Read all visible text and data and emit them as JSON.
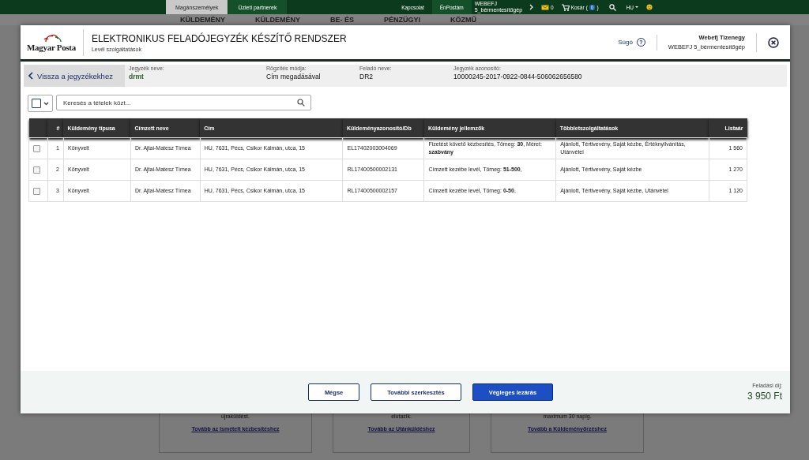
{
  "top_bar": {
    "tabs": [
      {
        "label": "Magánszemélyek",
        "selected": true
      },
      {
        "label": "Üzleti partnerek",
        "selected": false
      }
    ],
    "links": [
      "Kapcsolat",
      "ÉnPostám"
    ],
    "account": [
      "WEBEFJ",
      "5_bérmentesítőgép"
    ],
    "messages_count": "0",
    "cart": {
      "label": "Kosár",
      "open": "(",
      "count": "0",
      "close": ")"
    },
    "language": "HU"
  },
  "nav": [
    "KÜLDEMÉNY",
    "KÜLDEMÉNY",
    "BE- ÉS",
    "PÉNZÜGYI",
    "KÖZMŰ"
  ],
  "background_cards": [
    {
      "text": "újraküldést.",
      "link": "Tovább az Ismételt kézbesítéshez"
    },
    {
      "text": "elutazik.",
      "link": "Tovább az Utánküldéshez"
    },
    {
      "text": "maximum 30 napig.",
      "link": "Tovább a Küldeményőrzéshez"
    }
  ],
  "dialog": {
    "logo": "Magyar Posta",
    "title": "ELEKTRONIKUS FELADÓJEGYZÉK KÉSZÍTŐ RENDSZER",
    "subtitle": "Levél szolgáltatások",
    "help": "Súgó",
    "help_icon": "?",
    "user_name": "Webefj Tizenegy",
    "user_org": "WEBEFJ 5_bérmentesítőgép",
    "back": "Vissza a jegyzékekhez",
    "info": [
      {
        "label": "Jegyzék neve:",
        "value": "drmt"
      },
      {
        "label": "Rögzítés módja:",
        "value": "Cím megadásával"
      },
      {
        "label": "Feladó neve:",
        "value": "DR2"
      },
      {
        "label": "Jegyzék azonosító:",
        "value": "10000245-2017-0922-0844-506062656580"
      }
    ],
    "search": {
      "placeholder": "Keresés a tételek közt...",
      "select_all_checked": false
    },
    "table": {
      "columns": [
        "#",
        "Küldemény típusa",
        "Címzett neve",
        "Cím",
        "Küldeményazonosító/Db",
        "Küldemény jellemzők",
        "Többletszolgáltatások",
        "Listaár"
      ],
      "rows": [
        {
          "checked": false,
          "cells": [
            "1",
            "Könyvelt",
            "Dr. Ajtai-Matesz Tímea",
            "HU, 7631, Pécs, Csikor Kálmán, utca, 15",
            "EL17402003004069",
            "Fizetést követő kézbesítés, Tömeg: **30**, Méret: **szabvány**",
            "Ajánlott, Tértivevény, Saját kézbe, Értéknyilvánítás, Utánvétel",
            "1 560"
          ]
        },
        {
          "checked": false,
          "cells": [
            "2",
            "Könyvelt",
            "Dr. Ajtai-Matesz Tímea",
            "HU, 7631, Pécs, Csikor Kálmán, utca, 15",
            "RL17400500002131",
            "Címzett kezébe levél, Tömeg: **51-500**,",
            "Ajánlott, Tértivevény, Saját kézbe",
            "1 270"
          ]
        },
        {
          "checked": false,
          "cells": [
            "3",
            "Könyvelt",
            "Dr. Ajtai-Matesz Tímea",
            "HU, 7631, Pécs, Csikor Kálmán, utca, 15",
            "RL17400500002157",
            "Címzett kezébe levél, Tömeg: **0-50**,",
            "Ajánlott, Tértivevény, Saját kézbe, Utánvétel",
            "1 120"
          ]
        }
      ]
    },
    "buttons": [
      {
        "label": "Mégse",
        "kind": "secondary"
      },
      {
        "label": "További szerkesztés",
        "kind": "secondary"
      },
      {
        "label": "Végleges lezárás",
        "kind": "primary"
      }
    ],
    "fee": {
      "label": "Feladási díj:",
      "value": "3 950 Ft"
    }
  }
}
